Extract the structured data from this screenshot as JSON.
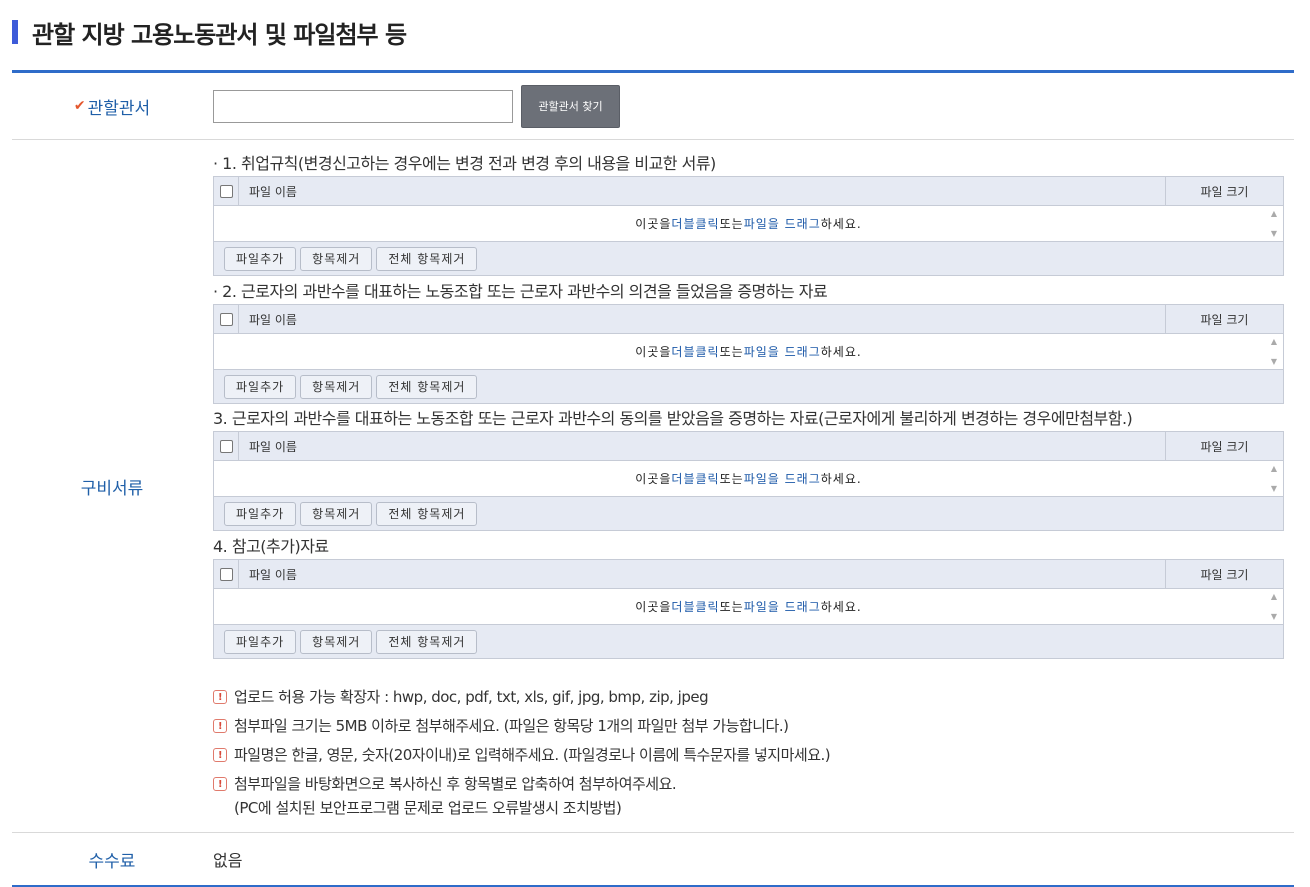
{
  "header": {
    "title": "관할 지방 고용노동관서 및 파일첨부 등"
  },
  "office": {
    "label": "관할관서",
    "input_value": "",
    "find_button": "관할관서 찾기"
  },
  "docs": {
    "label": "구비서류",
    "uploader": {
      "col_name": "파일 이름",
      "col_size": "파일 크기",
      "drop_a": "이곳을 ",
      "drop_b": "더블클릭",
      "drop_c": " 또는 ",
      "drop_d": "파일을 드래그",
      "drop_e": " 하세요.",
      "add_button": "파일추가",
      "remove_button": "항목제거",
      "remove_all_button": "전체 항목제거"
    },
    "items": [
      {
        "title": "· 1. 취업규칙(변경신고하는 경우에는 변경 전과 변경 후의 내용을 비교한 서류)"
      },
      {
        "title": "· 2. 근로자의 과반수를 대표하는 노동조합 또는 근로자 과반수의 의견을 들었음을 증명하는 자료"
      },
      {
        "title": "3. 근로자의 과반수를 대표하는 노동조합 또는 근로자 과반수의 동의를 받았음을 증명하는 자료(근로자에게 불리하게 변경하는 경우에만첨부함.)"
      },
      {
        "title": "4. 참고(추가)자료"
      }
    ],
    "notes": [
      "업로드 허용 가능 확장자 : hwp, doc, pdf, txt, xls, gif, jpg, bmp, zip, jpeg",
      "첨부파일 크기는 5MB 이하로 첨부해주세요. (파일은 항목당 1개의 파일만 첨부 가능합니다.)",
      "파일명은 한글, 영문, 숫자(20자이내)로 입력해주세요. (파일경로나 이름에 특수문자를 넣지마세요.)",
      "첨부파일을 바탕화면으로 복사하신 후 항목별로 압축하여 첨부하여주세요."
    ],
    "note_sub": "(PC에 설치된 보안프로그램 문제로 업로드 오류발생시 조치방법)",
    "note_icon": "!"
  },
  "fee": {
    "label": "수수료",
    "value": "없음"
  },
  "colors": {
    "accent": "#3d5bd9",
    "label": "#1f5fa8",
    "border_top": "#2f6cc9",
    "highlight": "#1b58a8"
  }
}
